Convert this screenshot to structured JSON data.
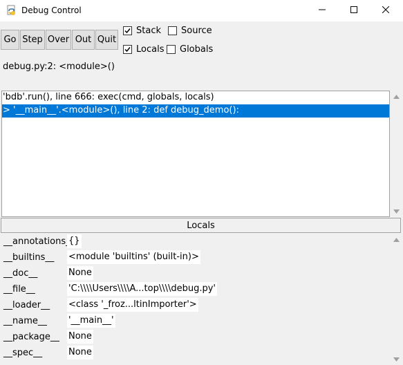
{
  "window": {
    "title": "Debug Control",
    "icon": "python-idle-icon"
  },
  "toolbar": {
    "buttons": [
      "Go",
      "Step",
      "Over",
      "Out",
      "Quit"
    ],
    "checkboxes": [
      {
        "label": "Stack",
        "checked": true
      },
      {
        "label": "Source",
        "checked": false
      },
      {
        "label": "Locals",
        "checked": true
      },
      {
        "label": "Globals",
        "checked": false
      }
    ]
  },
  "status": "debug.py:2: <module>()",
  "stack": {
    "rows": [
      {
        "text": "'bdb'.run(), line 666: exec(cmd, globals, locals)",
        "selected": false
      },
      {
        "text": "> '__main__'.<module>(), line 2: def debug_demo():",
        "selected": true
      }
    ]
  },
  "locals": {
    "header": "Locals",
    "rows": [
      {
        "name": "__annotations__",
        "value": "{}"
      },
      {
        "name": "__builtins__",
        "value": "<module 'builtins' (built-in)>"
      },
      {
        "name": "__doc__",
        "value": "None"
      },
      {
        "name": "__file__",
        "value": "'C:\\\\\\\\Users\\\\\\\\A...top\\\\\\\\debug.py'"
      },
      {
        "name": "__loader__",
        "value": "<class '_froz...ltinImporter'>"
      },
      {
        "name": "__name__",
        "value": "'__main__'"
      },
      {
        "name": "__package__",
        "value": "None"
      },
      {
        "name": "__spec__",
        "value": "None"
      }
    ]
  },
  "colors": {
    "selection": "#0078d7",
    "window_bg": "#f0f0f0"
  }
}
